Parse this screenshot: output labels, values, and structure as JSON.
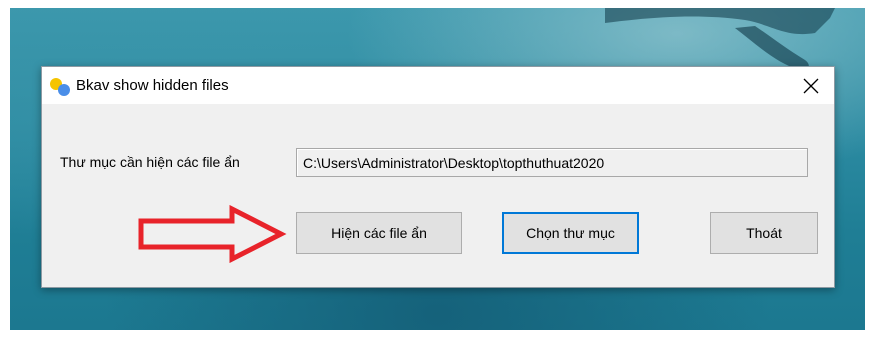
{
  "window": {
    "title": "Bkav show hidden files",
    "close_label": "Close"
  },
  "form": {
    "folder_label": "Thư mục cần hiện các file ẩn",
    "folder_path": "C:\\Users\\Administrator\\Desktop\\topthuthuat2020"
  },
  "buttons": {
    "show_hidden": "Hiện các file ẩn",
    "choose_folder": "Chọn thư mục",
    "exit": "Thoát"
  },
  "annotation": {
    "arrow_icon": "red-outline-arrow-icon",
    "arrow_color": "#e8232a"
  },
  "colors": {
    "focus_border": "#0078d7",
    "dialog_bg": "#f0f0f0",
    "button_bg": "#e1e1e1"
  }
}
